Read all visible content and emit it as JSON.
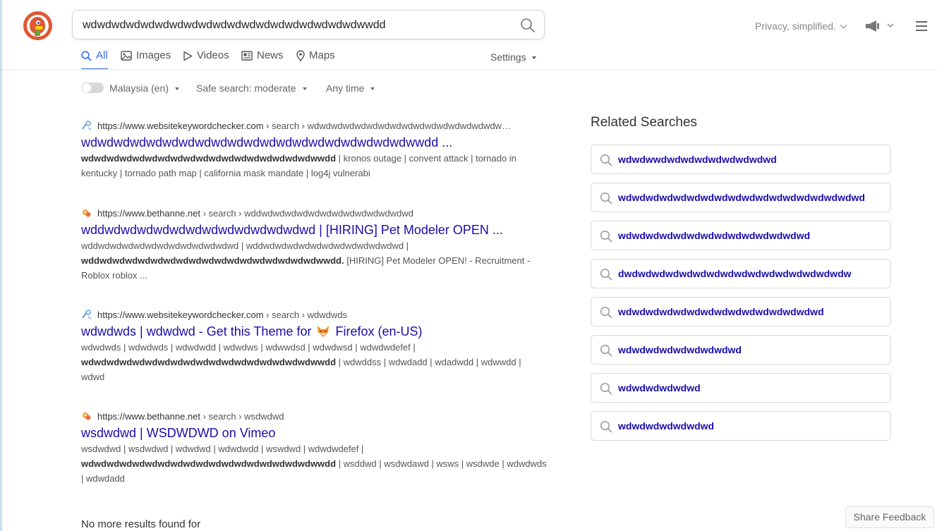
{
  "search": {
    "query": "wdwdwdwdwdwdwdwdwdwdwdwdwdwdwdwdwdwdwdwwdd"
  },
  "header": {
    "privacy_label": "Privacy, simplified."
  },
  "tabs": [
    {
      "label": "All",
      "icon": "search-icon",
      "active": true
    },
    {
      "label": "Images",
      "icon": "image-icon"
    },
    {
      "label": "Videos",
      "icon": "play-icon"
    },
    {
      "label": "News",
      "icon": "news-icon"
    },
    {
      "label": "Maps",
      "icon": "map-pin-icon"
    }
  ],
  "settings_label": "Settings",
  "filters": {
    "region": "Malaysia (en)",
    "safe_search": "Safe search: moderate",
    "time": "Any time"
  },
  "results": [
    {
      "domain": "https://www.websitekeywordchecker.com",
      "path": " › search › wdwdwdwdwdwdwdwdwdwdwdwdwdwdwdwdw…",
      "title": "wdwdwdwdwdwdwdwdwdwdwdwdwdwdwdwdwdwdwdwdwwdd ...",
      "snippet_bold": "wdwdwdwdwdwdwdwdwdwdwdwdwdwdwdwdwdwdwwdd",
      "snippet_rest": " | kronos outage | convent attack | tornado in kentucky | tornado path map | california mask mandate | log4j vulnerabi"
    },
    {
      "domain": "https://www.bethanne.net",
      "path": " › search › wddwdwdwdwdwdwdwdwdwdwdwdwdwd",
      "title": "wddwdwdwdwdwdwdwdwdwdwdwdwdwd | [HIRING] Pet Modeler OPEN ...",
      "snippet_pre": "wddwdwdwdwdwdwdwdwdwdwdwdwd | wddwdwdwdwdwdwdwdwdwdwdwdwd | ",
      "snippet_bold": "wddwdwdwdwdwdwdwdwdwdwdwdwdwdwdwdwdwdwwdd.",
      "snippet_rest": " [HIRING] Pet Modeler OPEN! - Recruitment - Roblox roblox ..."
    },
    {
      "domain": "https://www.websitekeywordchecker.com",
      "path": " › search › wdwdwds",
      "title_pre": "wdwdwds | wdwdwd - Get this Theme for ",
      "title_post": " Firefox (en-US)",
      "snippet_pre": "wdwdwds | wdwdwds | wdwdwdd | wdwdws | wdwwdsd | wdwdwsd | wdwdwdefef | ",
      "snippet_bold": "wdwdwdwdwdwdwdwdwdwdwdwdwdwdwdwdwdwdwwdd",
      "snippet_rest": " | wdwddss | wdwdadd | wdadwdd | wdwwdd | wdwd"
    },
    {
      "domain": "https://www.bethanne.net",
      "path": " › search › wsdwdwd",
      "title": "wsdwdwd | WSDWDWD on Vimeo",
      "snippet_pre": "wsdwdwd | wsdwdwd | wdwdwd | wdwdwdd | wswdwd | wdwdwdefef | ",
      "snippet_bold": "wdwdwdwdwdwdwdwdwdwdwdwdwdwdwdwdwdwdwwdd",
      "snippet_rest": " | wsddwd | wsdwdawd | wsws | wsdwde | wdwdwds | wdwdadd"
    }
  ],
  "no_more_text": "No more results found for",
  "related": {
    "title": "Related Searches",
    "items": [
      "wdwdwwdwdwdwdwdwdwdwdwd",
      "wdwdwdwdwdwdwdwdwdwdwdwdwdwdwdwdwdwd",
      "wdwdwdwdwdwdwdwdwdwdwdwdwdwd",
      "dwdwdwdwdwdwdwdwdwdwdwdwdwdwdwdwdw",
      "wdwdwdwdwdwdwdwdwdwdwdwdwdwdwd",
      "wdwdwdwdwdwdwdwdwd",
      "wdwdwdwdwdwd",
      "wdwdwdwdwdwdwd"
    ]
  },
  "feedback_label": "Share Feedback",
  "colors": {
    "brand": "#de5833",
    "accent": "#3969ef",
    "link": "#1a0dab"
  }
}
